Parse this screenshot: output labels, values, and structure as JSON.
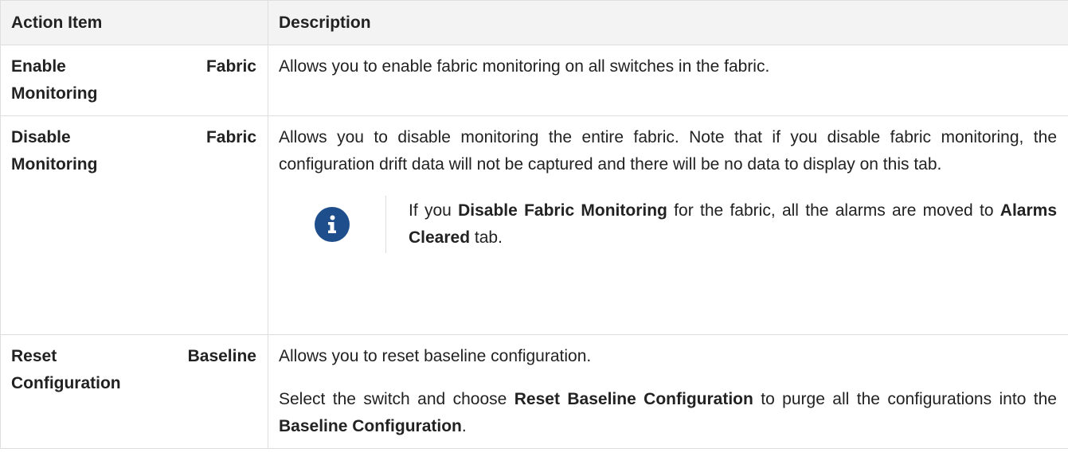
{
  "table": {
    "headers": [
      "Action Item",
      "Description"
    ],
    "rows": [
      {
        "action_line1": "Enable Fabric",
        "action_line2": "Monitoring",
        "desc": "Allows you to enable fabric monitoring on all switches in the fabric."
      },
      {
        "action_line1": "Disable Fabric",
        "action_line2": "Monitoring",
        "desc": "Allows you to disable monitoring the entire fabric. Note that if you disable fabric monitoring, the configuration drift data will not be captured and there will be no data to display on this tab.",
        "note": {
          "icon": "info-icon",
          "text_1": "If you ",
          "bold_1": "Disable Fabric Monitoring",
          "text_2": " for the fabric, all the alarms are moved to ",
          "bold_2": "Alarms Cleared",
          "text_3": " tab."
        }
      },
      {
        "action_line1": "Reset Baseline",
        "action_line2": "Configuration",
        "desc_p1": "Allows you to reset baseline configuration.",
        "desc_p2_text_1": "Select the switch and choose ",
        "desc_p2_bold_1": "Reset Baseline Configuration",
        "desc_p2_text_2": " to purge all the configurations into the ",
        "desc_p2_bold_2": "Baseline Configuration",
        "desc_p2_text_3": "."
      }
    ]
  },
  "colors": {
    "header_bg": "#f3f3f3",
    "border": "#dedede",
    "note_icon_bg": "#1f4e8c"
  }
}
